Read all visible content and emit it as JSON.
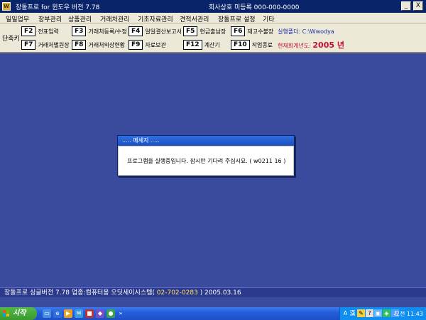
{
  "window": {
    "app_icon_text": "W",
    "title": "장돌프로  for 윈도우  버전 7.78",
    "company": "회사상호 미등록   000-000-0000",
    "minimize": "_",
    "close": "X"
  },
  "menu": [
    "일일업무",
    "장부관리",
    "상품관리",
    "거래처관리",
    "기초자료관리",
    "견적서관리",
    "장돌프로 설정",
    "기타"
  ],
  "toolbar": {
    "shortcut_label": "단축키",
    "row1": [
      {
        "key": "F2",
        "label": "전표입력"
      },
      {
        "key": "F3",
        "label": "거래처등록/수정"
      },
      {
        "key": "F4",
        "label": "일일결산보고서"
      },
      {
        "key": "F5",
        "label": "현금출납장"
      },
      {
        "key": "F6",
        "label": "재고수불장"
      }
    ],
    "row2": [
      {
        "key": "F7",
        "label": "거래처별원장"
      },
      {
        "key": "F8",
        "label": "거래처외상현황"
      },
      {
        "key": "F9",
        "label": "자료보관"
      },
      {
        "key": "F12",
        "label": "계산기"
      },
      {
        "key": "F10",
        "label": "작업종료"
      }
    ],
    "exec_folder": "실행폴더: C:\\Wwodya",
    "fiscal_year_label": "현재회계년도: ",
    "fiscal_year_value": "2005 년"
  },
  "dialog": {
    "title": "..... 메세지 .....",
    "message": "프로그램을 실행중입니다. 잠시만 기다려 주십시요. ( w0211   16 )"
  },
  "statusbar": {
    "text": "장돌프로 싱글버전 7.78    업종:컴퓨터용    오딧세이시스템(",
    "phone": " 02-702-0283 ",
    "tail": ")    2005.03.16"
  },
  "taskbar": {
    "start_label": "시작",
    "quick_launch_more": "»",
    "tray_lang": "A",
    "tray_hanja": "漢",
    "clock": "오전 11:43"
  },
  "colors": {
    "desktop": "#3a4a9c",
    "titlebar": "#0a246a",
    "fiscal_red": "#c8102e",
    "folder_blue": "#1a2aa8"
  }
}
